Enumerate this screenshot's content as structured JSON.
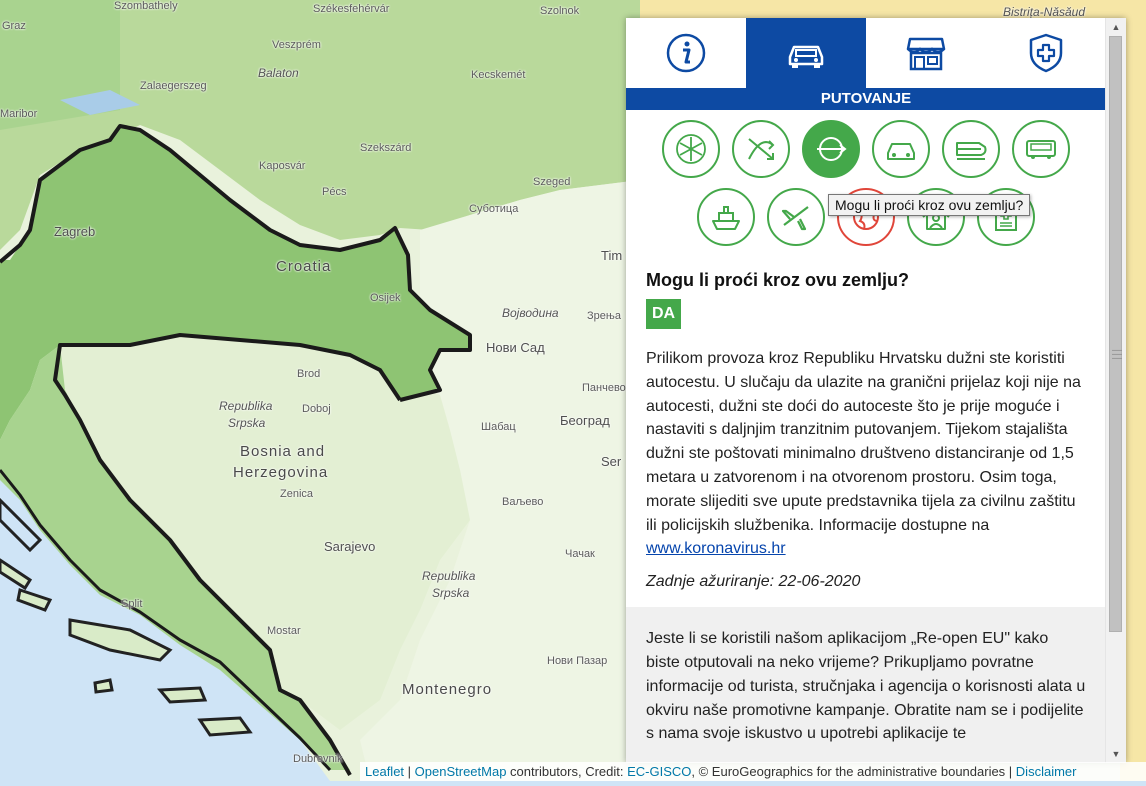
{
  "map": {
    "places": {
      "szombathely": "Szombathely",
      "szekesfehervar": "Székesfehérvár",
      "szolnok": "Szolnok",
      "bistrita": "Bistrița-Năsăud",
      "graz": "Graz",
      "veszprem": "Veszprém",
      "kecskemet": "Kecskemét",
      "zalaegerszeg": "Zalaegerszeg",
      "balaton": "Balaton",
      "maribor": "Maribor",
      "szekszard": "Szekszárd",
      "kaposvar": "Kaposvár",
      "pecs": "Pécs",
      "szeged": "Szeged",
      "subotica": "Суботица",
      "zagreb": "Zagreb",
      "croatia": "Croatia",
      "osijek": "Osijek",
      "timisoara": "Tim",
      "vojvodina": "Војводина",
      "zrenjanin": "Зрења",
      "novisad": "Нови Сад",
      "brod": "Brod",
      "pancevo": "Панчево",
      "rs1": "Republika",
      "rs1b": "Srpska",
      "doboj": "Doboj",
      "bih": "Bosnia and",
      "bih2": "Herzegovina",
      "sabac": "Шабац",
      "beograd": "Београд",
      "ser": "Ser",
      "zenica": "Zenica",
      "valjevo": "Ваљево",
      "sarajevo": "Sarajevo",
      "cacak": "Чачак",
      "rs2": "Republika",
      "rs2b": "Srpska",
      "split": "Split",
      "mostar": "Mostar",
      "novipazar": "Нови Пазар",
      "montenegro": "Montenegro",
      "dubrovnik": "Dubrovnik"
    }
  },
  "panel": {
    "tabs": [
      {
        "name": "info",
        "icon": "info-icon"
      },
      {
        "name": "travel",
        "icon": "car-icon"
      },
      {
        "name": "shop",
        "icon": "store-icon"
      },
      {
        "name": "health",
        "icon": "shield-cross-icon"
      }
    ],
    "active_tab": "travel",
    "section_title": "PUTOVANJE",
    "circle_icons_row1": [
      "snowflake-icon",
      "swap-arrows-icon",
      "transit-icon",
      "car-icon",
      "train-icon",
      "bus-icon"
    ],
    "circle_icons_row2": [
      "ship-icon",
      "plane-icon",
      "globe-virus-icon",
      "home-quarantine-icon",
      "medical-certificate-icon"
    ],
    "tooltip": "Mogu li proći kroz ovu zemlju?",
    "question": "Mogu li proći kroz ovu zemlju?",
    "answer_badge": "DA",
    "body": "Prilikom provoza kroz Republiku Hrvatsku dužni ste koristiti autocestu. U slučaju da ulazite na granični prijelaz koji nije na autocesti, dužni ste doći do autoceste što je prije moguće i nastaviti s daljnjim tranzitnim putovanjem. Tijekom stajališta dužni ste poštovati minimalno društveno distanciranje od 1,5 metara u zatvorenom i na otvorenom prostoru. Osim toga, morate slijediti sve upute predstavnika tijela za civilnu zaštitu ili policijskih službenika. Informacije dostupne na ",
    "link": "www.koronavirus.hr",
    "updated": "Zadnje ažuriranje: 22-06-2020",
    "promo": "Jeste li se koristili našom aplikacijom „Re-open EU\" kako biste otputovali na neko vrijeme? Prikupljamo povratne informacije od turista, stručnjaka i agencija o korisnosti alata u okviru naše promotivne kampanje. Obratite nam se i podijelite s nama svoje iskustvo u upotrebi aplikacije te"
  },
  "colors": {
    "accent_blue": "#0d4aa3",
    "accent_green": "#44a84a",
    "alert_red": "#e0463a"
  },
  "attribution": {
    "leaflet": "Leaflet",
    "sep1": " | ",
    "osm": "OpenStreetMap",
    "contrib": " contributors, Credit: ",
    "gisco": "EC-GISCO",
    "rest": ", © EuroGeographics for the administrative boundaries | ",
    "disclaimer": "Disclaimer"
  }
}
